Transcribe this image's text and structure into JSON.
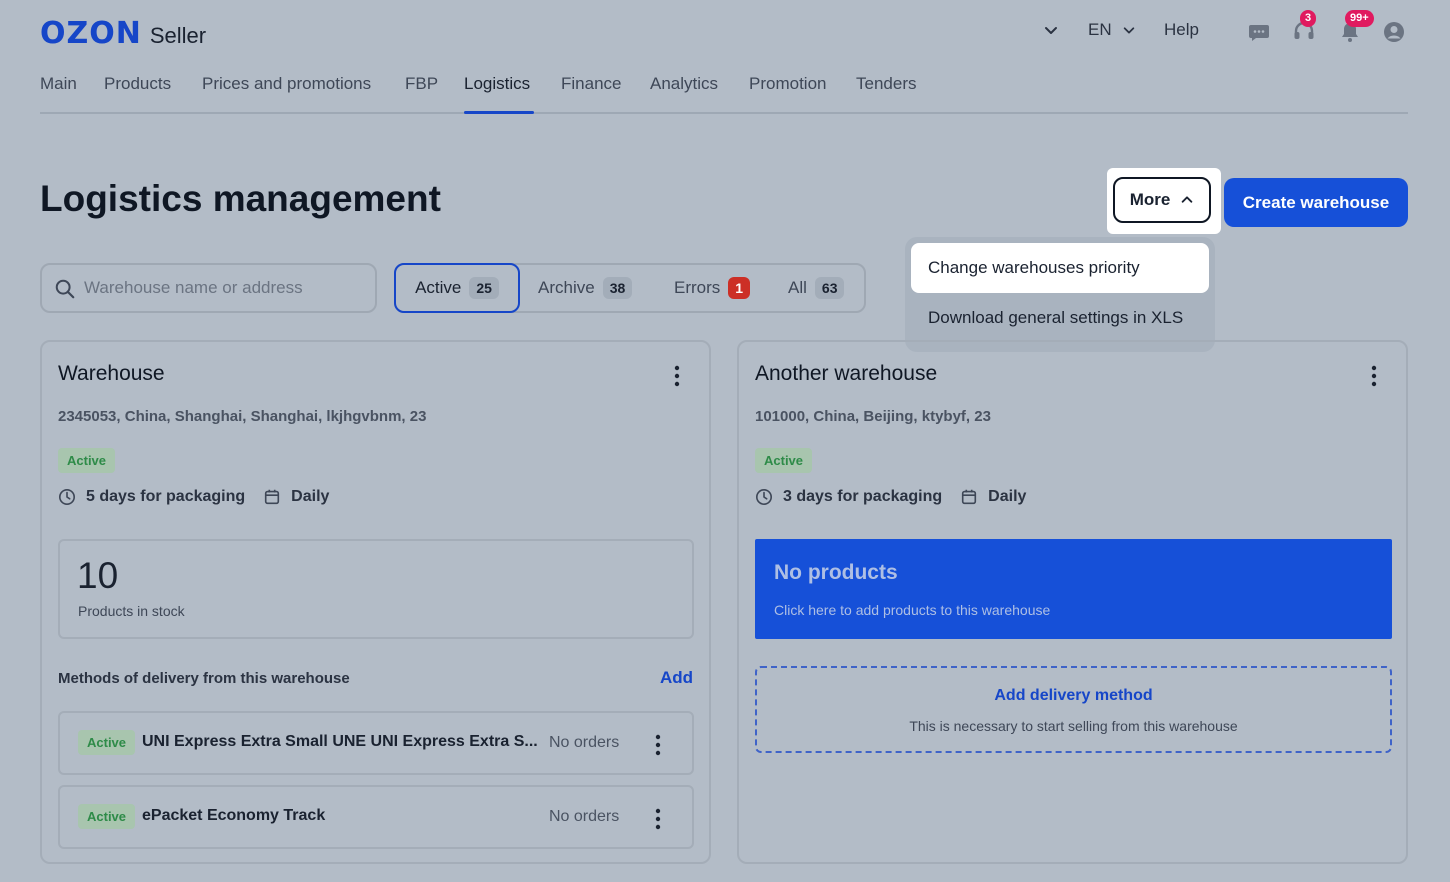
{
  "header": {
    "logo_brand": "OZON",
    "logo_product": "Seller",
    "lang": "EN",
    "help": "Help",
    "support_badge": "3",
    "notifications_badge": "99+"
  },
  "nav": {
    "items": [
      "Main",
      "Products",
      "Prices and promotions",
      "FBP",
      "Logistics",
      "Finance",
      "Analytics",
      "Promotion",
      "Tenders"
    ],
    "active": "Logistics"
  },
  "page": {
    "title": "Logistics management",
    "more_label": "More",
    "create_label": "Create warehouse"
  },
  "more_menu": {
    "items": [
      "Change warehouses priority",
      "Download general settings in XLS"
    ]
  },
  "search": {
    "placeholder": "Warehouse name or address"
  },
  "filters": {
    "active": {
      "label": "Active",
      "count": "25"
    },
    "archive": {
      "label": "Archive",
      "count": "38"
    },
    "errors": {
      "label": "Errors",
      "count": "1"
    },
    "all": {
      "label": "All",
      "count": "63"
    }
  },
  "warehouses": [
    {
      "name": "Warehouse",
      "address": "2345053, China, Shanghai, Shanghai, lkjhgvbnm, 23",
      "status": "Active",
      "packaging": "5 days for packaging",
      "schedule": "Daily",
      "stock_count": "10",
      "stock_label": "Products in stock",
      "methods_heading": "Methods of delivery from this warehouse",
      "methods_add": "Add",
      "methods": [
        {
          "status": "Active",
          "name": "UNI Express Extra Small UNE UNI Express Extra S...",
          "orders": "No orders"
        },
        {
          "status": "Active",
          "name": "ePacket Economy Track",
          "orders": "No orders"
        }
      ]
    },
    {
      "name": "Another warehouse",
      "address": "101000, China, Beijing, ktybyf, 23",
      "status": "Active",
      "packaging": "3 days for packaging",
      "schedule": "Daily",
      "no_products_title": "No products",
      "no_products_sub": "Click here to add products to this warehouse",
      "add_delivery_title": "Add delivery method",
      "add_delivery_sub": "This is necessary to start selling from this warehouse"
    }
  ],
  "colors": {
    "accent": "#1646c8",
    "background": "#b3bcc7",
    "error_badge": "#cc2f26",
    "status_green": "#2e8b48"
  },
  "icons": [
    "chevron-down-icon",
    "chat-icon",
    "support-icon",
    "bell-icon",
    "user-icon",
    "search-icon",
    "chevron-up-icon",
    "kebab-icon",
    "clock-icon",
    "calendar-icon"
  ]
}
